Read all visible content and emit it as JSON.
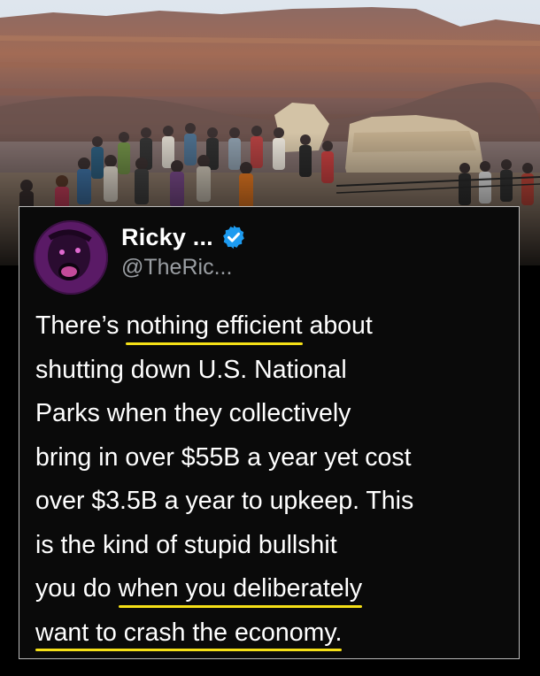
{
  "post": {
    "display_name": "Ricky ...",
    "handle": "@TheRic...",
    "verified": true,
    "text_lines": [
      {
        "pre": "There’s ",
        "hl": "nothing efficient",
        "post": " about"
      },
      {
        "pre": "shutting down U.S. National",
        "hl": "",
        "post": ""
      },
      {
        "pre": "Parks when they collectively",
        "hl": "",
        "post": ""
      },
      {
        "pre": "bring in over $55B a year yet cost",
        "hl": "",
        "post": ""
      },
      {
        "pre": "over $3.5B a year to upkeep. This",
        "hl": "",
        "post": ""
      },
      {
        "pre": "is the kind of stupid bullshit",
        "hl": "",
        "post": ""
      },
      {
        "pre": "you do ",
        "hl": "when you deliberately",
        "post": ""
      },
      {
        "pre": "",
        "hl": "want to crash the economy.",
        "post": ""
      }
    ]
  },
  "icons": {
    "verified": "verified-badge-icon",
    "avatar": "avatar"
  },
  "colors": {
    "card_background": "#0a0a0a",
    "card_border": "#b9b9b9",
    "text": "#ffffff",
    "handle": "#9a9ea3",
    "highlight_underline": "#f5e017",
    "verified_badge": "#1d9bf0"
  }
}
